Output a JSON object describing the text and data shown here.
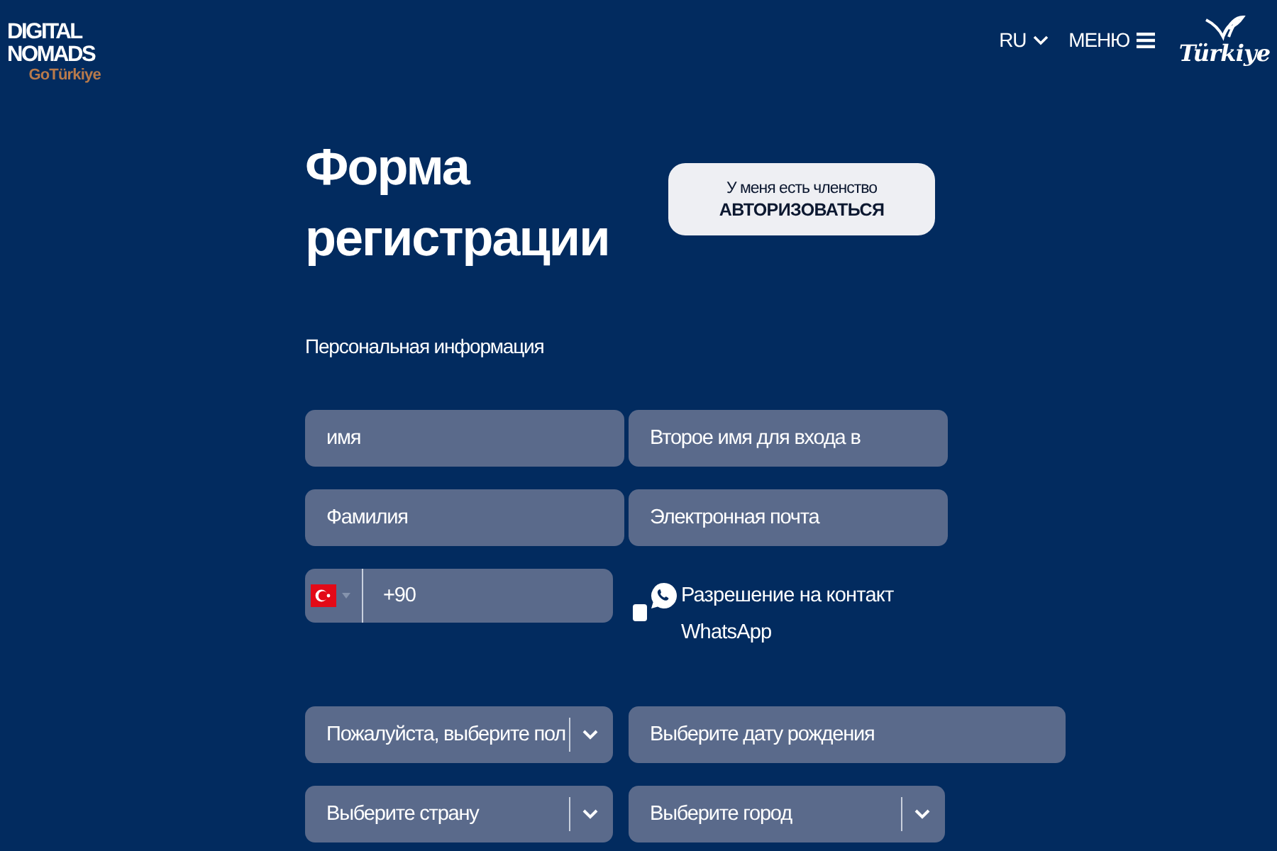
{
  "header": {
    "logo": {
      "line1": "DIGITAL",
      "line2": "NOMADS",
      "brand": "GoTürkiye"
    },
    "language": "RU",
    "menu": "МЕНЮ",
    "brand_logo": "Türkiye"
  },
  "form": {
    "title": "Форма регистрации",
    "login_button": {
      "caption": "У меня есть членство",
      "label": "АВТОРИЗОВАТЬСЯ"
    },
    "section": "Персональная информация",
    "rows": [
      [
        {
          "kind": "text",
          "placeholder": "имя"
        },
        {
          "kind": "text",
          "placeholder": "Второе имя для входа в"
        }
      ],
      [
        {
          "kind": "text",
          "placeholder": "Фамилия"
        },
        {
          "kind": "text",
          "placeholder": "Электронная почта"
        }
      ],
      [
        {
          "kind": "phone",
          "placeholder": "+90"
        },
        {
          "kind": "checkbox",
          "label": "Разрешение на контакт WhatsApp",
          "checked": false
        }
      ],
      [
        {
          "kind": "select",
          "placeholder": "Пожалуйста, выберите пол"
        },
        {
          "kind": "date",
          "placeholder": "Выберите дату рождения"
        }
      ],
      [
        {
          "kind": "select",
          "placeholder": "Выберите страну"
        },
        {
          "kind": "select",
          "placeholder": "Выберите город"
        }
      ]
    ]
  }
}
